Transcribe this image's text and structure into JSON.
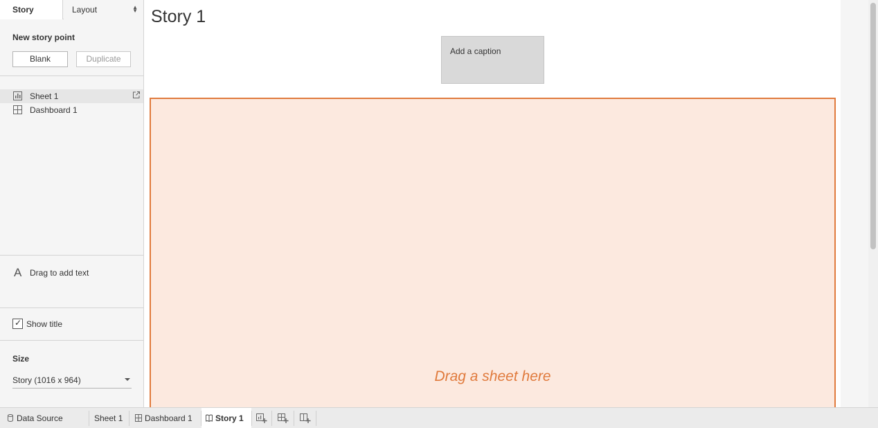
{
  "left_panel": {
    "tabs": {
      "story": "Story",
      "layout": "Layout"
    },
    "new_story_point": {
      "label": "New story point",
      "blank_button": "Blank",
      "duplicate_button": "Duplicate"
    },
    "sheets": [
      {
        "label": "Sheet 1",
        "icon": "sheet-icon",
        "selected": true
      },
      {
        "label": "Dashboard 1",
        "icon": "dashboard-icon",
        "selected": false
      }
    ],
    "text_object": {
      "label": "Drag to add text",
      "glyph": "A"
    },
    "show_title": {
      "label": "Show title",
      "checked": true,
      "check_glyph": "✓"
    },
    "size": {
      "label": "Size",
      "value": "Story (1016 x 964)"
    }
  },
  "main": {
    "title": "Story 1",
    "caption": "Add a caption",
    "drop_text": "Drag a sheet here",
    "colors": {
      "drop_bg": "#fce9df",
      "drop_border": "#e07a3c"
    }
  },
  "bottom_tabs": {
    "data_source": "Data Source",
    "sheet1": "Sheet 1",
    "dashboard1": "Dashboard 1",
    "story1": "Story 1"
  }
}
